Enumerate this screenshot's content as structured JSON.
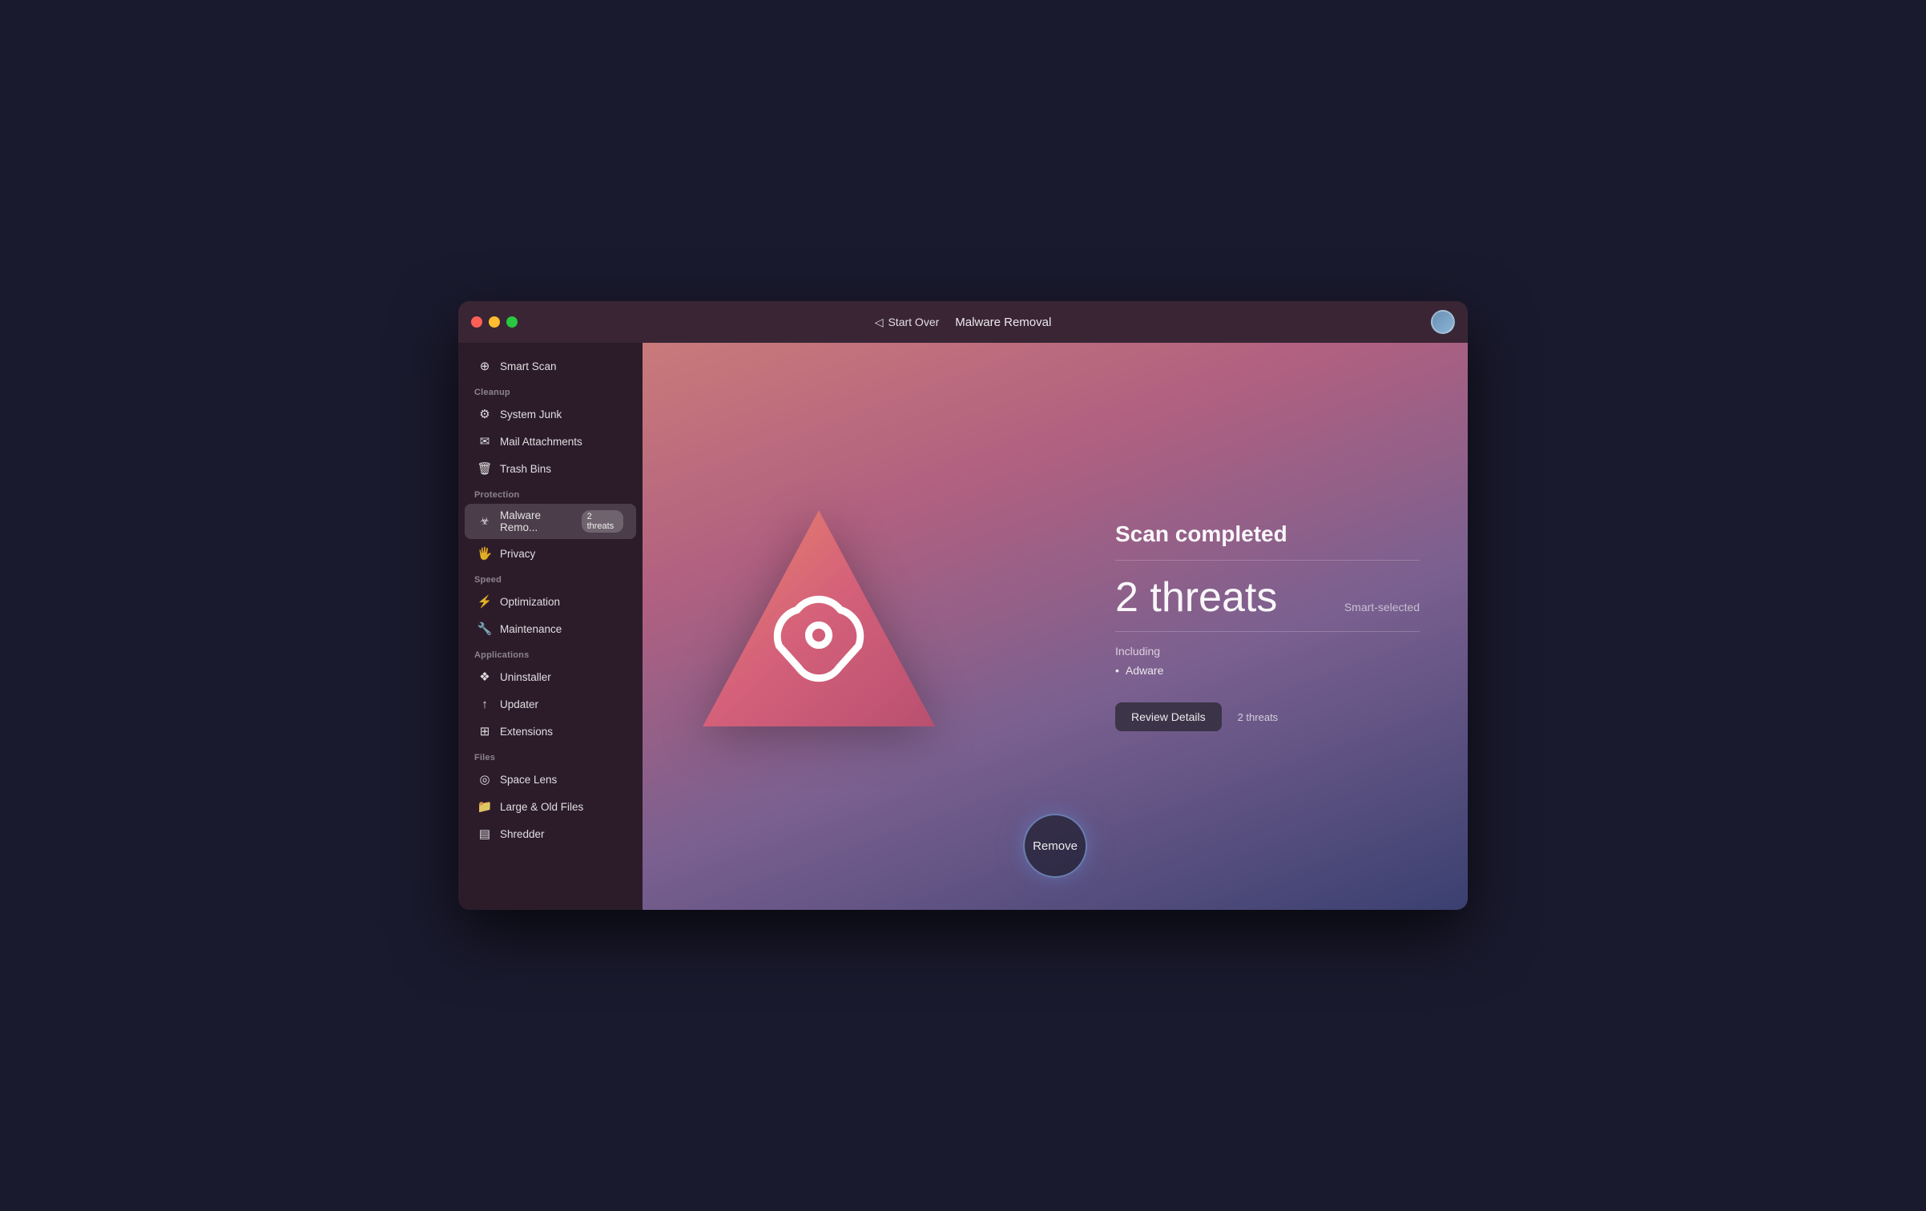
{
  "window": {
    "title": "Malware Removal"
  },
  "titlebar": {
    "start_over": "Start Over",
    "title": "Malware Removal"
  },
  "sidebar": {
    "smart_scan": "Smart Scan",
    "sections": [
      {
        "label": "Cleanup",
        "items": [
          {
            "id": "system-junk",
            "label": "System Junk",
            "icon": "⚙"
          },
          {
            "id": "mail-attachments",
            "label": "Mail Attachments",
            "icon": "✉"
          },
          {
            "id": "trash-bins",
            "label": "Trash Bins",
            "icon": "🗑"
          }
        ]
      },
      {
        "label": "Protection",
        "items": [
          {
            "id": "malware-removal",
            "label": "Malware Remo...",
            "icon": "☣",
            "active": true,
            "badge": "2 threats"
          },
          {
            "id": "privacy",
            "label": "Privacy",
            "icon": "🖐"
          }
        ]
      },
      {
        "label": "Speed",
        "items": [
          {
            "id": "optimization",
            "label": "Optimization",
            "icon": "⚡"
          },
          {
            "id": "maintenance",
            "label": "Maintenance",
            "icon": "🔧"
          }
        ]
      },
      {
        "label": "Applications",
        "items": [
          {
            "id": "uninstaller",
            "label": "Uninstaller",
            "icon": "❖"
          },
          {
            "id": "updater",
            "label": "Updater",
            "icon": "↑"
          },
          {
            "id": "extensions",
            "label": "Extensions",
            "icon": "⊞"
          }
        ]
      },
      {
        "label": "Files",
        "items": [
          {
            "id": "space-lens",
            "label": "Space Lens",
            "icon": "◎"
          },
          {
            "id": "large-old-files",
            "label": "Large & Old Files",
            "icon": "📁"
          },
          {
            "id": "shredder",
            "label": "Shredder",
            "icon": "▤"
          }
        ]
      }
    ]
  },
  "main": {
    "scan_completed": "Scan completed",
    "threats_count": "2 threats",
    "smart_selected": "Smart-selected",
    "including_label": "Including",
    "adware": "Adware",
    "review_details_label": "Review Details",
    "threats_small": "2 threats",
    "remove_label": "Remove"
  }
}
